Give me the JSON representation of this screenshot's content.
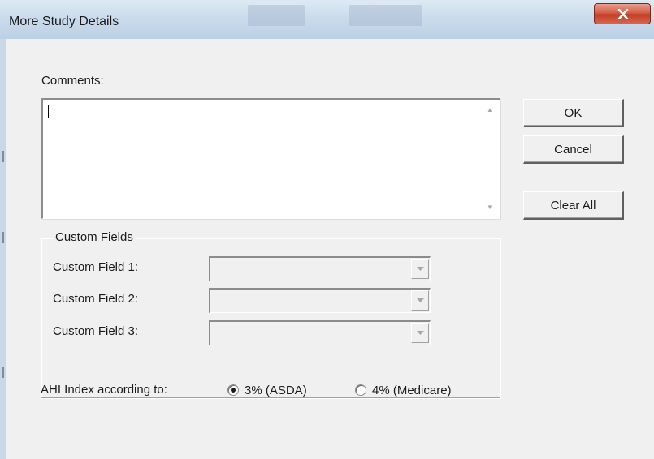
{
  "window": {
    "title": "More Study Details",
    "close_icon": "close-icon"
  },
  "comments": {
    "label": "Comments:",
    "value": ""
  },
  "buttons": {
    "ok": "OK",
    "cancel": "Cancel",
    "clear_all": "Clear All"
  },
  "custom_fields": {
    "legend": "Custom Fields",
    "fields": [
      {
        "label": "Custom Field 1:",
        "value": ""
      },
      {
        "label": "Custom Field 2:",
        "value": ""
      },
      {
        "label": "Custom Field 3:",
        "value": ""
      }
    ]
  },
  "ahi": {
    "label": "AHI Index according to:",
    "options": [
      {
        "label": "3% (ASDA)",
        "selected": true
      },
      {
        "label": "4% (Medicare)",
        "selected": false
      }
    ]
  },
  "colors": {
    "titlebar": "#c9daec",
    "close_button": "#c94a31",
    "dialog_bg": "#f0f0f0"
  }
}
